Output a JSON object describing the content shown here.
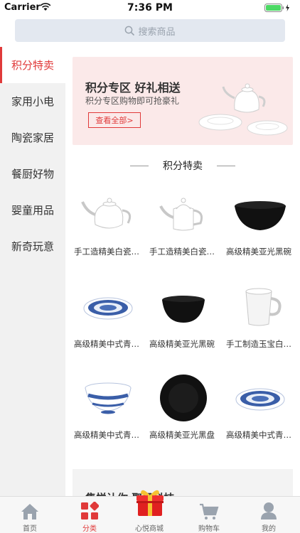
{
  "status_bar": {
    "carrier": "Carrier",
    "time": "7:36 PM"
  },
  "search": {
    "placeholder": "搜索商品"
  },
  "sidebar": {
    "items": [
      {
        "label": "积分特卖",
        "active": true
      },
      {
        "label": "家用小电",
        "active": false
      },
      {
        "label": "陶瓷家居",
        "active": false
      },
      {
        "label": "餐厨好物",
        "active": false
      },
      {
        "label": "婴童用品",
        "active": false
      },
      {
        "label": "新奇玩意",
        "active": false
      }
    ]
  },
  "banner": {
    "title": "积分专区 好礼相送",
    "subtitle": "积分专区购物即可抢豪礼",
    "button": "查看全部>"
  },
  "section": {
    "title": "积分特卖"
  },
  "products": [
    {
      "name": "手工造精美白瓷茶壶",
      "icon": "teapot-icon"
    },
    {
      "name": "手工造精美白瓷茶壶",
      "icon": "tall-teapot-icon"
    },
    {
      "name": "高级精美亚光黑碗",
      "icon": "black-bowl-icon"
    },
    {
      "name": "高级精美中式青花盘",
      "icon": "blue-plate-icon"
    },
    {
      "name": "高级精美亚光黑碗",
      "icon": "black-bowl-icon"
    },
    {
      "name": "手工制造玉宝白瓷杯",
      "icon": "white-mug-icon"
    },
    {
      "name": "高级精美中式青花碗",
      "icon": "blue-bowl-icon"
    },
    {
      "name": "高级精美亚光黑盘",
      "icon": "black-plate-icon"
    },
    {
      "name": "高级精美中式青花盘",
      "icon": "blue-plate-icon"
    }
  ],
  "bottom_banner": {
    "text": "隽悦让你  聚黑科技"
  },
  "tab_bar": {
    "tabs": [
      {
        "label": "首页",
        "icon": "home-icon",
        "active": false
      },
      {
        "label": "分类",
        "icon": "category-icon",
        "active": true
      },
      {
        "label": "心悦商城",
        "icon": "gift-icon",
        "active": false
      },
      {
        "label": "购物车",
        "icon": "cart-icon",
        "active": false
      },
      {
        "label": "我的",
        "icon": "profile-icon",
        "active": false
      }
    ]
  },
  "colors": {
    "accent": "#e03a3a",
    "search_bg": "#e3e8f0",
    "sidebar_bg": "#f1f1f1",
    "banner_bg": "#fbe9e9",
    "icon_gray": "#9aa3ae"
  }
}
